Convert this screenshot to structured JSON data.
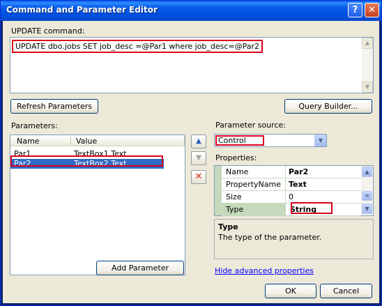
{
  "window": {
    "title": "Command and Parameter Editor",
    "help_button": "?",
    "close_button": "✕"
  },
  "command": {
    "label": "UPDATE command:",
    "value": "UPDATE dbo.jobs SET job_desc =@Par1 where job_desc=@Par2"
  },
  "buttons": {
    "refresh": "Refresh Parameters",
    "query_builder": "Query Builder...",
    "add_parameter": "Add Parameter",
    "ok": "OK",
    "cancel": "Cancel"
  },
  "parameters": {
    "label": "Parameters:",
    "columns": [
      "Name",
      "Value"
    ],
    "rows": [
      {
        "name": "Par1",
        "value": "TextBox1.Text",
        "selected": false
      },
      {
        "name": "Par2",
        "value": "TextBox2.Text",
        "selected": true
      }
    ]
  },
  "side_buttons": {
    "move_up": "▲",
    "move_down": "▼",
    "remove": "✕"
  },
  "parameter_source": {
    "label": "Parameter source:",
    "value": "Control"
  },
  "properties": {
    "label": "Properties:",
    "rows": [
      {
        "name": "Name",
        "value": "Par2",
        "bold": true
      },
      {
        "name": "PropertyName",
        "value": "Text",
        "bold": true
      },
      {
        "name": "Size",
        "value": "0",
        "bold": false
      },
      {
        "name": "Type",
        "value": "String",
        "bold": true
      }
    ]
  },
  "description": {
    "title": "Type",
    "text": "The type of the parameter."
  },
  "hide_advanced_link": "Hide advanced properties",
  "colors": {
    "highlight_outline": "#d9001b",
    "selection": "#316ac5",
    "dialog_bg": "#ece9d8"
  }
}
